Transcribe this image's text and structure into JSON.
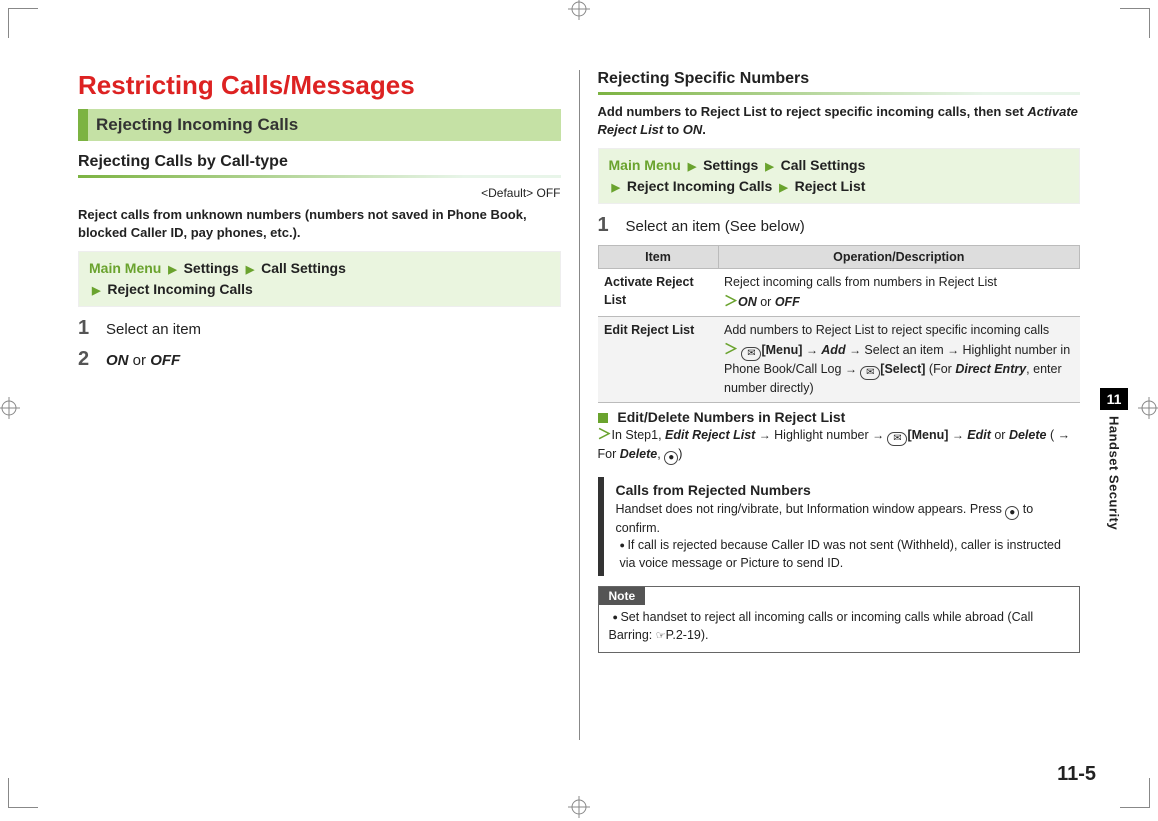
{
  "page_number": "11-5",
  "chapter": {
    "number": "11",
    "title": "Handset Security"
  },
  "left": {
    "page_title": "Restricting Calls/Messages",
    "section_heading": "Rejecting Incoming Calls",
    "sub_heading": "Rejecting Calls by Call-type",
    "default_tag": "<Default> OFF",
    "intro": "Reject calls from unknown numbers (numbers not saved in Phone Book, blocked Caller ID, pay phones, etc.).",
    "nav": {
      "main_menu": "Main Menu",
      "p1": "Settings",
      "p2": "Call Settings",
      "p3": "Reject Incoming Calls"
    },
    "steps": [
      {
        "n": "1",
        "text": "Select an item"
      },
      {
        "n": "2",
        "text_on": "ON",
        "text_or": " or ",
        "text_off": "OFF"
      }
    ]
  },
  "right": {
    "sub_heading": "Rejecting Specific Numbers",
    "intro_a": "Add numbers to Reject List to reject specific incoming calls, then set ",
    "intro_activate": "Activate Reject List",
    "intro_to": " to ",
    "intro_on": "ON",
    "intro_period": ".",
    "nav": {
      "main_menu": "Main Menu",
      "p1": "Settings",
      "p2": "Call Settings",
      "p3": "Reject Incoming Calls",
      "p4": "Reject List"
    },
    "step1": {
      "n": "1",
      "text": "Select an item (See below)"
    },
    "table": {
      "col_item": "Item",
      "col_op": "Operation/Description",
      "rows": [
        {
          "item": "Activate Reject List",
          "desc_a": "Reject incoming calls from numbers in Reject List",
          "on": "ON",
          "or": " or ",
          "off": "OFF"
        },
        {
          "item": "Edit Reject List",
          "desc_a": "Add numbers to Reject List to reject specific incoming calls",
          "menu": "[Menu]",
          "add": "Add",
          "sel_item": "Select an item",
          "highlight": "Highlight number in Phone Book/Call Log",
          "select": "[Select]",
          "for": " (For ",
          "direct_entry": "Direct Entry",
          "tail": ", enter number directly)"
        }
      ]
    },
    "edit_delete": {
      "title": "Edit/Delete Numbers in Reject List",
      "pre": "In Step1, ",
      "erl": "Edit Reject List",
      "hl": "Highlight number",
      "menu": "[Menu]",
      "edit": "Edit",
      "or": " or ",
      "delete": "Delete",
      "for": " ( → For ",
      "delete2": "Delete",
      "tail": ", "
    },
    "tip": {
      "title": "Calls from Rejected Numbers",
      "body_a": "Handset does not ring/vibrate, but Information window appears. Press ",
      "body_b": " to confirm.",
      "bullet": "If call is rejected because Caller ID was not sent (Withheld), caller is instructed via voice message or Picture to send ID."
    },
    "note": {
      "label": "Note",
      "body_a": "Set handset to reject all incoming calls or incoming calls while abroad (Call Barring: ",
      "ref": "P.2-19",
      "tail": ")."
    }
  }
}
